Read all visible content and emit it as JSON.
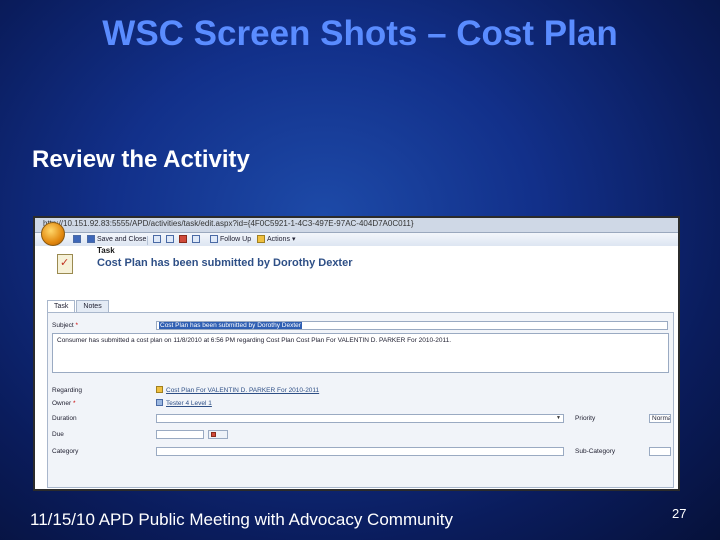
{
  "slide": {
    "title": "WSC Screen Shots – Cost Plan",
    "subheading": "Review the Activity",
    "footer": "11/15/10 APD Public Meeting with Advocacy Community",
    "page_number": "27"
  },
  "screenshot": {
    "url": "http://10.151.92.83:5555/APD/activities/task/edit.aspx?id={4F0C5921-1-4C3-497E-97AC-404D7A0C011}",
    "toolbar": {
      "save_and_close": "Save and Close",
      "follow_up": "Follow Up",
      "actions": "Actions"
    },
    "header": {
      "entity_label": "Task",
      "subject": "Cost Plan has been submitted by Dorothy Dexter"
    },
    "tabs": [
      "Task",
      "Notes"
    ],
    "form": {
      "subject_label": "Subject",
      "subject_value": "Cost Plan has been submitted by Dorothy Dexter",
      "description": "Consumer has submitted a cost plan on 11/8/2010 at 6:56 PM regarding Cost Plan Cost Plan For VALENTIN D. PARKER For 2010-2011.",
      "regarding_label": "Regarding",
      "regarding_value": "Cost Plan For VALENTIN D. PARKER For 2010-2011",
      "owner_label": "Owner",
      "owner_value": "Tester 4 Level 1",
      "duration_label": "Duration",
      "duration_value": "",
      "due_label": "Due",
      "due_value": "",
      "category_label": "Category",
      "category_value": "",
      "priority_label": "Priority",
      "priority_value": "Normal",
      "subcategory_label": "Sub-Category",
      "subcategory_value": ""
    }
  },
  "colors": {
    "title": "#5a8cff",
    "background": "#0a1c5c",
    "link": "#2e4f86"
  }
}
